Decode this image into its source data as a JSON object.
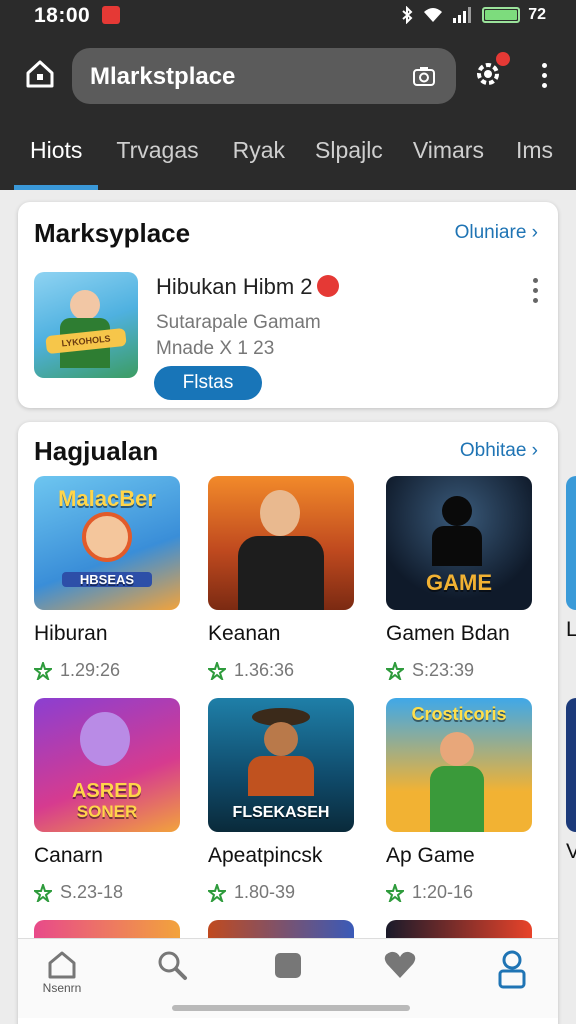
{
  "status": {
    "time": "18:00",
    "battery": "72"
  },
  "header": {
    "search_text": "Mlarkstplace"
  },
  "tabs": [
    {
      "label": "Hiots"
    },
    {
      "label": "Trvagas"
    },
    {
      "label": "Ryak"
    },
    {
      "label": "Slpajlc"
    },
    {
      "label": "Vimars"
    },
    {
      "label": "Ims"
    }
  ],
  "featured": {
    "title": "Marksyplace",
    "link": "Oluniare ›",
    "item_title": "Hibukan Hibm 2",
    "subtitle1": "Sutarapale Gamam",
    "subtitle2": "Mnade X 1 23",
    "button": "Flstas",
    "thumb_text": "LYKOHOLS"
  },
  "section": {
    "title": "Hagjualan",
    "link": "Obhitae ›"
  },
  "grid": [
    {
      "name": "Hiburan",
      "meta": "1.29:26",
      "thumb_text": "MalacBer",
      "thumb_sub": "HBSEAS"
    },
    {
      "name": "Keanan",
      "meta": "1.36:36",
      "thumb_text": "",
      "thumb_sub": ""
    },
    {
      "name": "Gamen Bdan",
      "meta": "S:23:39",
      "thumb_text": "GAME",
      "thumb_sub": ""
    },
    {
      "name": "Canarn",
      "meta": "S.23-18",
      "thumb_text": "ASRED",
      "thumb_sub": "SONER"
    },
    {
      "name": "Apeatpincsk",
      "meta": "1.80-39",
      "thumb_text": "FLSEKASEH",
      "thumb_sub": ""
    },
    {
      "name": "Ap Game",
      "meta": "1:20-16",
      "thumb_text": "Crosticoris",
      "thumb_sub": ""
    }
  ],
  "peek_labels": [
    "L",
    "V"
  ],
  "bottomnav": {
    "home_label": "Nsenrn"
  },
  "colors": {
    "accent": "#1875b8",
    "tab_indicator": "#3a98d8",
    "badge": "#e53935"
  }
}
